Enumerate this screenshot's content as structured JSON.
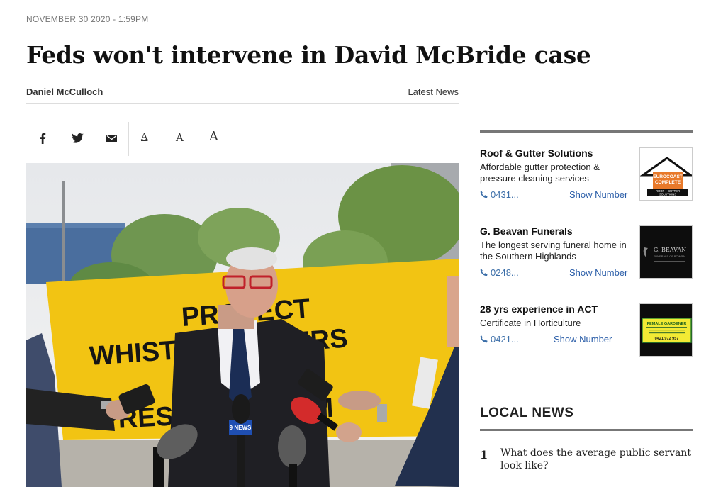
{
  "article": {
    "dateline": "NOVEMBER 30 2020 - 1:59PM",
    "headline": "Feds won't intervene in David McBride case",
    "author": "Daniel McCulloch",
    "section": "Latest News"
  },
  "share": {
    "icons": [
      "facebook-icon",
      "twitter-icon",
      "email-icon"
    ],
    "font_sizes": [
      "A",
      "A",
      "A"
    ]
  },
  "hero_photo": {
    "banner_lines": [
      "PROTECT",
      "WHISTLEBLOWERS",
      "PRESS FREEDOM"
    ],
    "mic_logo": "9 NEWS"
  },
  "sidebar": {
    "listings": [
      {
        "title": "Roof & Gutter Solutions",
        "desc": "Affordable gutter protection & pressure cleaning services",
        "phone": "0431...",
        "show": "Show Number",
        "logo": [
          "EUROCOAST",
          "COMPLETE",
          "ROOF + GUTTER",
          "SOLUTIONS"
        ]
      },
      {
        "title": "G. Beavan Funerals",
        "desc": "The longest serving funeral home in the Southern Highlands",
        "phone": "0248...",
        "show": "Show Number",
        "logo": [
          "G. BEAVAN",
          "FUNERALS OF BOWRAL"
        ]
      },
      {
        "title": "28 yrs experience in ACT",
        "desc": "Certificate in Horticulture",
        "phone": "0421...",
        "show": "Show Number",
        "logo": [
          "FEMALE GARDENER",
          "0421 972 957"
        ]
      }
    ],
    "local_news": {
      "heading": "LOCAL NEWS",
      "items": [
        {
          "num": "1",
          "title": "What does the average public servant look like?"
        }
      ]
    }
  },
  "colors": {
    "link": "#2a5da8",
    "rule": "#777777",
    "banner": "#f2c413"
  }
}
